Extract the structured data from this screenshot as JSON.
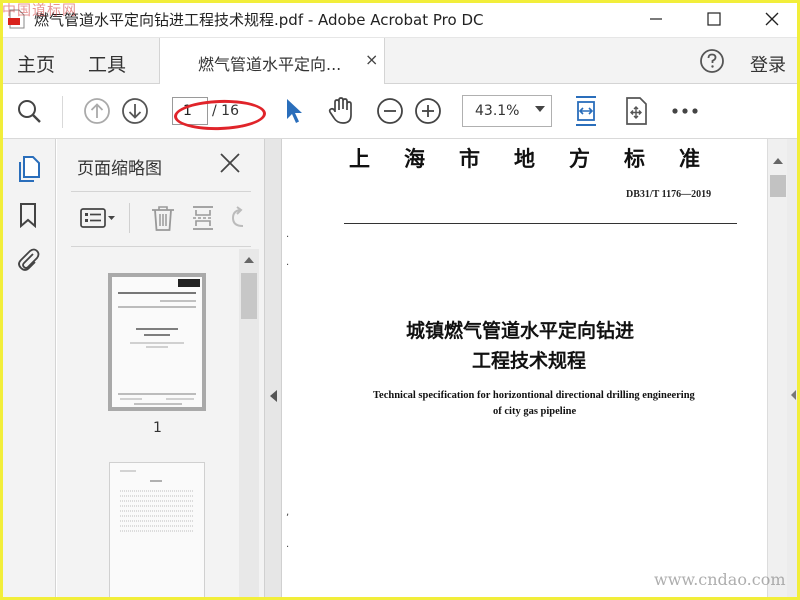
{
  "window": {
    "title": "燃气管道水平定向钻进工程技术规程.pdf - Adobe Acrobat Pro DC",
    "minimize_icon": "minimize-icon",
    "maximize_icon": "maximize-icon",
    "close_icon": "close-icon"
  },
  "watermarks": {
    "top_left": "中国道标网",
    "bottom_right": "www.cndao.com"
  },
  "tabs": {
    "home": "主页",
    "tools": "工具",
    "document": "燃气管道水平定向...",
    "document_close": "×",
    "login": "登录"
  },
  "toolbar": {
    "page_current": "1",
    "page_total": "/ 16",
    "zoom": "43.1%",
    "icons": [
      "search-icon",
      "page-up-icon",
      "page-down-icon",
      "select-cursor-icon",
      "hand-tool-icon",
      "zoom-out-icon",
      "zoom-in-icon",
      "fit-width-icon",
      "rotate-view-icon",
      "more-icon"
    ]
  },
  "left_strip": {
    "icons": [
      "page-thumbnails-icon",
      "bookmark-icon",
      "attachment-icon"
    ]
  },
  "thumbnail_panel": {
    "title": "页面缩略图",
    "page_number": "1",
    "tools": [
      "options-icon",
      "delete-icon",
      "insert-page-icon",
      "undo-icon"
    ]
  },
  "document": {
    "header": "上海市地方标准",
    "code": "DB31/T 1176—2019",
    "title_line1": "城镇燃气管道水平定向钻进",
    "title_line2": "工程技术规程",
    "english_line1": "Technical specification for horizontional directional drilling engineering",
    "english_line2": "of city gas pipeline"
  },
  "colors": {
    "accent_blue": "#2a6ebb",
    "highlight_red": "#e0242a",
    "frame_yellow": "#f2ee3a"
  }
}
